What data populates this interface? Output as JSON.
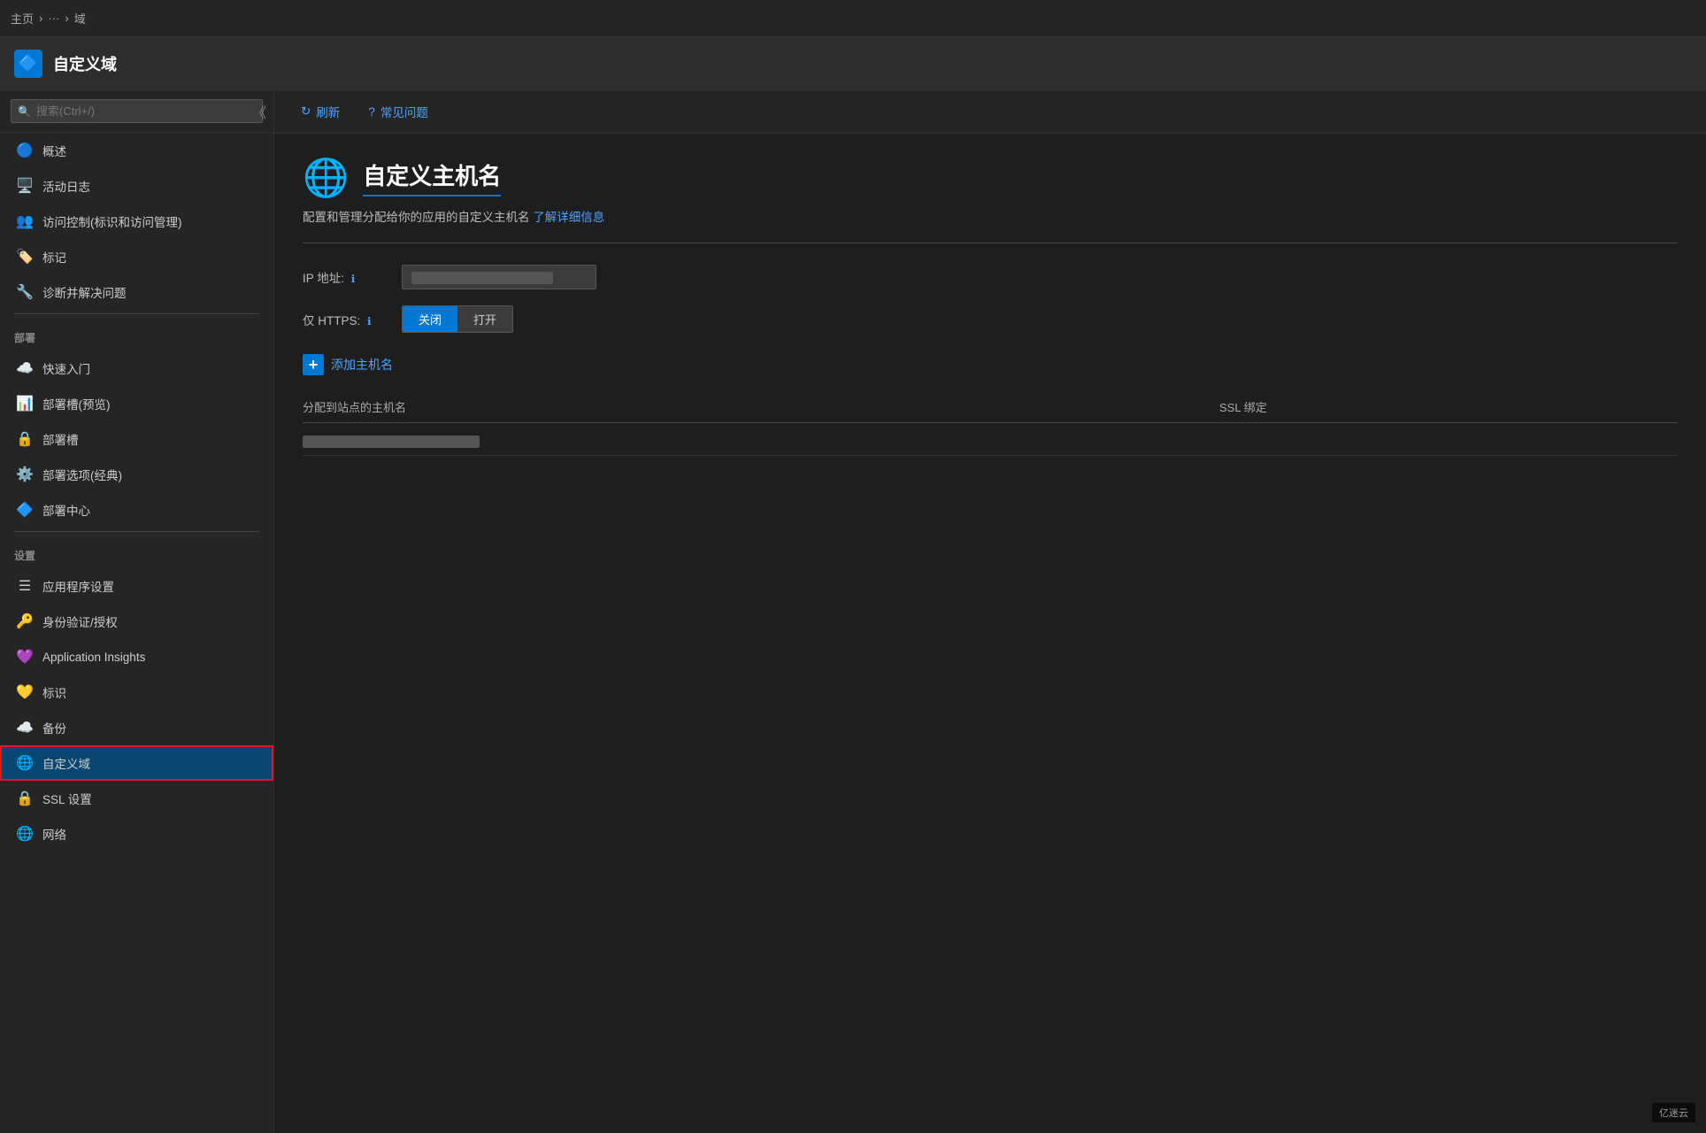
{
  "topbar": {
    "breadcrumb": [
      "主页",
      "·",
      "···",
      "域"
    ]
  },
  "subheader": {
    "icon": "🔷",
    "title": "自定义域"
  },
  "sidebar": {
    "search_placeholder": "搜索(Ctrl+/)",
    "sections": [
      {
        "label": "",
        "items": [
          {
            "id": "overview",
            "icon": "🔵",
            "label": "概述"
          },
          {
            "id": "activity-log",
            "icon": "🖥️",
            "label": "活动日志"
          },
          {
            "id": "access-control",
            "icon": "👥",
            "label": "访问控制(标识和访问管理)"
          },
          {
            "id": "tags",
            "icon": "🏷️",
            "label": "标记"
          },
          {
            "id": "diagnose",
            "icon": "🔧",
            "label": "诊断并解决问题"
          }
        ]
      },
      {
        "label": "部署",
        "items": [
          {
            "id": "quickstart",
            "icon": "☁️",
            "label": "快速入门"
          },
          {
            "id": "deploy-slot-preview",
            "icon": "📊",
            "label": "部署槽(预览)"
          },
          {
            "id": "deploy-slot",
            "icon": "🔒",
            "label": "部署槽"
          },
          {
            "id": "deploy-options-classic",
            "icon": "⚙️",
            "label": "部署选项(经典)"
          },
          {
            "id": "deploy-center",
            "icon": "🔷",
            "label": "部署中心"
          }
        ]
      },
      {
        "label": "设置",
        "items": [
          {
            "id": "app-settings",
            "icon": "☰",
            "label": "应用程序设置"
          },
          {
            "id": "auth",
            "icon": "🔑",
            "label": "身份验证/授权"
          },
          {
            "id": "app-insights",
            "icon": "💜",
            "label": "Application Insights"
          },
          {
            "id": "identity",
            "icon": "💛",
            "label": "标识"
          },
          {
            "id": "backup",
            "icon": "☁️",
            "label": "备份"
          },
          {
            "id": "custom-domain",
            "icon": "🔵",
            "label": "自定义域",
            "active": true
          },
          {
            "id": "ssl-settings",
            "icon": "🔒",
            "label": "SSL 设置"
          },
          {
            "id": "network",
            "icon": "🌐",
            "label": "网络"
          }
        ]
      }
    ]
  },
  "toolbar": {
    "refresh_label": "刷新",
    "faq_label": "常见问题"
  },
  "content": {
    "page_icon": "🌐",
    "page_title": "自定义主机名",
    "page_desc": "配置和管理分配给你的应用的自定义主机名",
    "page_desc_link": "了解详细信息",
    "ip_label": "IP 地址:",
    "ip_value": "██████████████",
    "https_label": "仅 HTTPS:",
    "https_off": "关闭",
    "https_on": "打开",
    "add_hostname_label": "添加主机名",
    "table": {
      "col_hostname": "分配到站点的主机名",
      "col_ssl": "SSL 绑定",
      "rows": [
        {
          "hostname": "██████████████████",
          "ssl": ""
        }
      ]
    }
  },
  "watermark": "亿迷云"
}
